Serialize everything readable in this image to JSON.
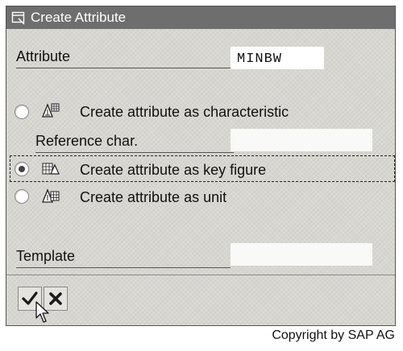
{
  "window": {
    "title": "Create Attribute"
  },
  "attribute": {
    "label": "Attribute",
    "value": "MINBW"
  },
  "options": {
    "characteristic": {
      "label": "Create attribute as characteristic",
      "selected": false
    },
    "reference": {
      "label": "Reference char.",
      "value": ""
    },
    "key_figure": {
      "label": "Create attribute as key figure",
      "selected": true
    },
    "unit": {
      "label": "Create attribute as unit",
      "selected": false
    }
  },
  "template": {
    "label": "Template",
    "value": ""
  },
  "toolbar": {
    "continue": {
      "icon": "checkmark-icon"
    },
    "cancel": {
      "icon": "cancel-x-icon"
    }
  },
  "footer": {
    "copyright": "Copyright by SAP AG"
  }
}
